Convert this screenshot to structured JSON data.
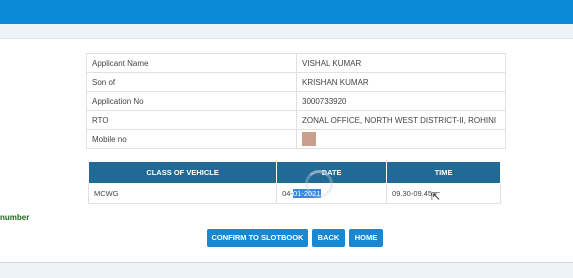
{
  "applicant": {
    "rows": [
      {
        "label": "Applicant Name",
        "value": "VISHAL KUMAR"
      },
      {
        "label": "Son of",
        "value": "KRISHAN KUMAR"
      },
      {
        "label": "Application No",
        "value": "3000733920"
      },
      {
        "label": "RTO",
        "value": "ZONAL OFFICE, NORTH WEST DISTRICT-II, ROHINI"
      },
      {
        "label": "Mobile no",
        "value": ""
      }
    ]
  },
  "slot": {
    "headers": [
      "CLASS OF VEHICLE",
      "DATE",
      "TIME"
    ],
    "row": {
      "class": "MCWG",
      "date_prefix": "04-",
      "date_selected": "01-2021",
      "time": "09.30-09.45"
    }
  },
  "side_label": "number",
  "buttons": {
    "confirm": "CONFIRM TO SLOTBOOK",
    "back": "BACK",
    "home": "HOME"
  },
  "colors": {
    "header_bar": "#0b8ad8",
    "table_header": "#1f6b95",
    "button": "#1a87d1",
    "selection": "#3b88e0"
  }
}
